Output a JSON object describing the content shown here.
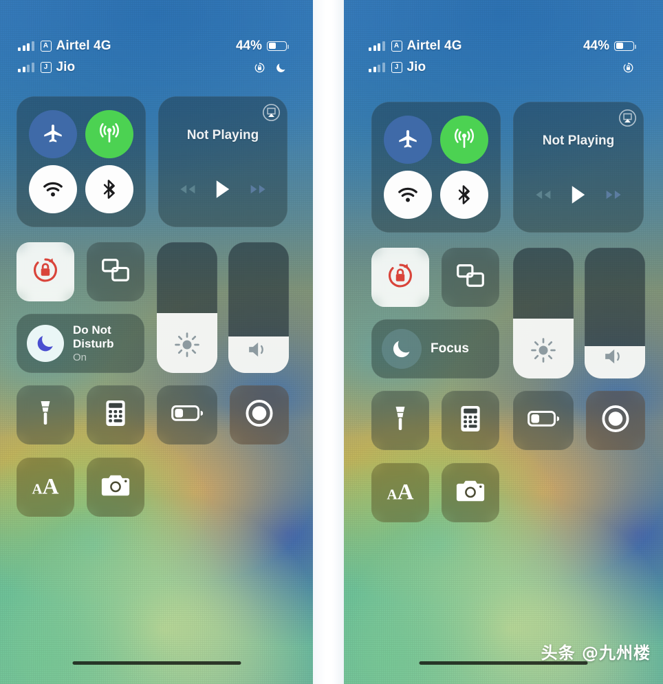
{
  "meta": {
    "watermark": "头条 @九州楼",
    "panel_count": 2
  },
  "colors": {
    "cellular_on": "#4cd252",
    "airplane_off": "#3f6aa8",
    "toggle_off_bg": "#ffffff",
    "rotation_lock_red": "#d9443a",
    "slider_fill": "#fbfbf8",
    "tile_bg": "rgba(40,52,52,0.42)"
  },
  "panels": [
    {
      "id": "left",
      "name": "ios-14-control-center",
      "status": {
        "sim1": {
          "label": "Airtel 4G",
          "badge": "A",
          "signal_bars": 3,
          "signal_max": 4
        },
        "sim2": {
          "label": "Jio",
          "badge": "J",
          "signal_bars": 2,
          "signal_max": 4
        },
        "battery_percent": "44%",
        "battery_level": 44,
        "icons": [
          "rotation-lock-icon",
          "do-not-disturb-moon-icon"
        ]
      },
      "connectivity": {
        "airplane": {
          "name": "airplane-mode",
          "state": "off"
        },
        "cellular": {
          "name": "cellular-data",
          "state": "on"
        },
        "wifi": {
          "name": "wifi",
          "state": "off"
        },
        "bluetooth": {
          "name": "bluetooth",
          "state": "off"
        }
      },
      "media": {
        "title": "Not Playing",
        "airplay": "airplay-icon",
        "controls": [
          "rewind",
          "play",
          "fast-forward"
        ]
      },
      "rotation_lock": {
        "label": "rotation-lock",
        "state": "on"
      },
      "screen_mirroring": {
        "label": "screen-mirroring",
        "state": "off"
      },
      "brightness": {
        "label": "brightness",
        "value": 46
      },
      "volume": {
        "label": "volume",
        "value": 28
      },
      "focus": {
        "title": "Do Not Disturb",
        "subtitle": "On",
        "state": "on"
      },
      "shortcuts": [
        {
          "name": "flashlight-tile",
          "icon": "flashlight-icon"
        },
        {
          "name": "calculator-tile",
          "icon": "calculator-icon"
        },
        {
          "name": "low-power-mode-tile",
          "icon": "battery-icon"
        },
        {
          "name": "screen-record-tile",
          "icon": "record-icon"
        },
        {
          "name": "text-size-tile",
          "icon": "text-size-icon"
        },
        {
          "name": "camera-tile",
          "icon": "camera-icon"
        }
      ]
    },
    {
      "id": "right",
      "name": "ios-15-control-center",
      "status": {
        "sim1": {
          "label": "Airtel 4G",
          "badge": "A",
          "signal_bars": 3,
          "signal_max": 4
        },
        "sim2": {
          "label": "Jio",
          "badge": "J",
          "signal_bars": 2,
          "signal_max": 4
        },
        "battery_percent": "44%",
        "battery_level": 44,
        "icons": [
          "rotation-lock-icon"
        ]
      },
      "connectivity": {
        "airplane": {
          "name": "airplane-mode",
          "state": "off"
        },
        "cellular": {
          "name": "cellular-data",
          "state": "on"
        },
        "wifi": {
          "name": "wifi",
          "state": "off"
        },
        "bluetooth": {
          "name": "bluetooth",
          "state": "off"
        }
      },
      "media": {
        "title": "Not Playing",
        "airplay": "airplay-icon",
        "controls": [
          "rewind",
          "play",
          "fast-forward"
        ]
      },
      "rotation_lock": {
        "label": "rotation-lock",
        "state": "on"
      },
      "screen_mirroring": {
        "label": "screen-mirroring",
        "state": "off"
      },
      "brightness": {
        "label": "brightness",
        "value": 46
      },
      "volume": {
        "label": "volume",
        "value": 25
      },
      "focus": {
        "title": "Focus",
        "subtitle": "",
        "state": "off"
      },
      "shortcuts": [
        {
          "name": "flashlight-tile",
          "icon": "flashlight-icon"
        },
        {
          "name": "calculator-tile",
          "icon": "calculator-icon"
        },
        {
          "name": "low-power-mode-tile",
          "icon": "battery-icon"
        },
        {
          "name": "screen-record-tile",
          "icon": "record-icon"
        },
        {
          "name": "text-size-tile",
          "icon": "text-size-icon"
        },
        {
          "name": "camera-tile",
          "icon": "camera-icon"
        }
      ]
    }
  ]
}
